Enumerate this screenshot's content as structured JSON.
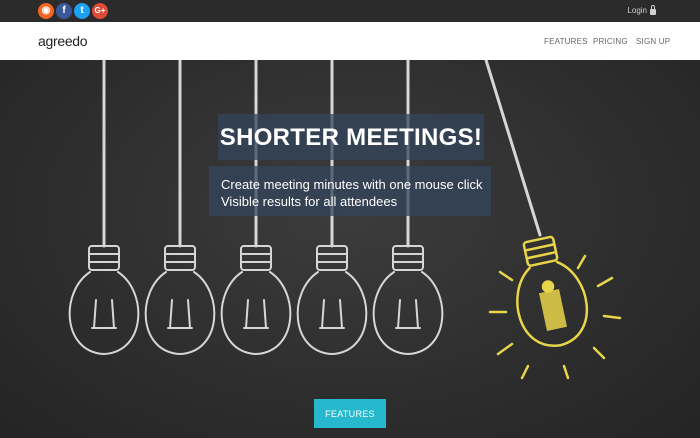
{
  "topbar": {
    "social": [
      {
        "name": "rss-icon",
        "glyph": "◉",
        "color": "#f26522"
      },
      {
        "name": "facebook-icon",
        "glyph": "f",
        "color": "#3b5998"
      },
      {
        "name": "twitter-icon",
        "glyph": "t",
        "color": "#1da1f2"
      },
      {
        "name": "google-plus-icon",
        "glyph": "G+",
        "color": "#dd4b39"
      }
    ],
    "login_label": "Login"
  },
  "navbar": {
    "brand": "agreedo",
    "links": [
      "FEATURES",
      "PRICING",
      "SIGN UP"
    ]
  },
  "hero": {
    "headline": "SHORTER MEETINGS!",
    "sub_lines": [
      "Create meeting minutes with one mouse click",
      "Visible results for all attendees"
    ],
    "cta_label": "FEATURES",
    "accent_color": "#26b8cc",
    "highlight_bulb_color": "#e8d54a"
  }
}
